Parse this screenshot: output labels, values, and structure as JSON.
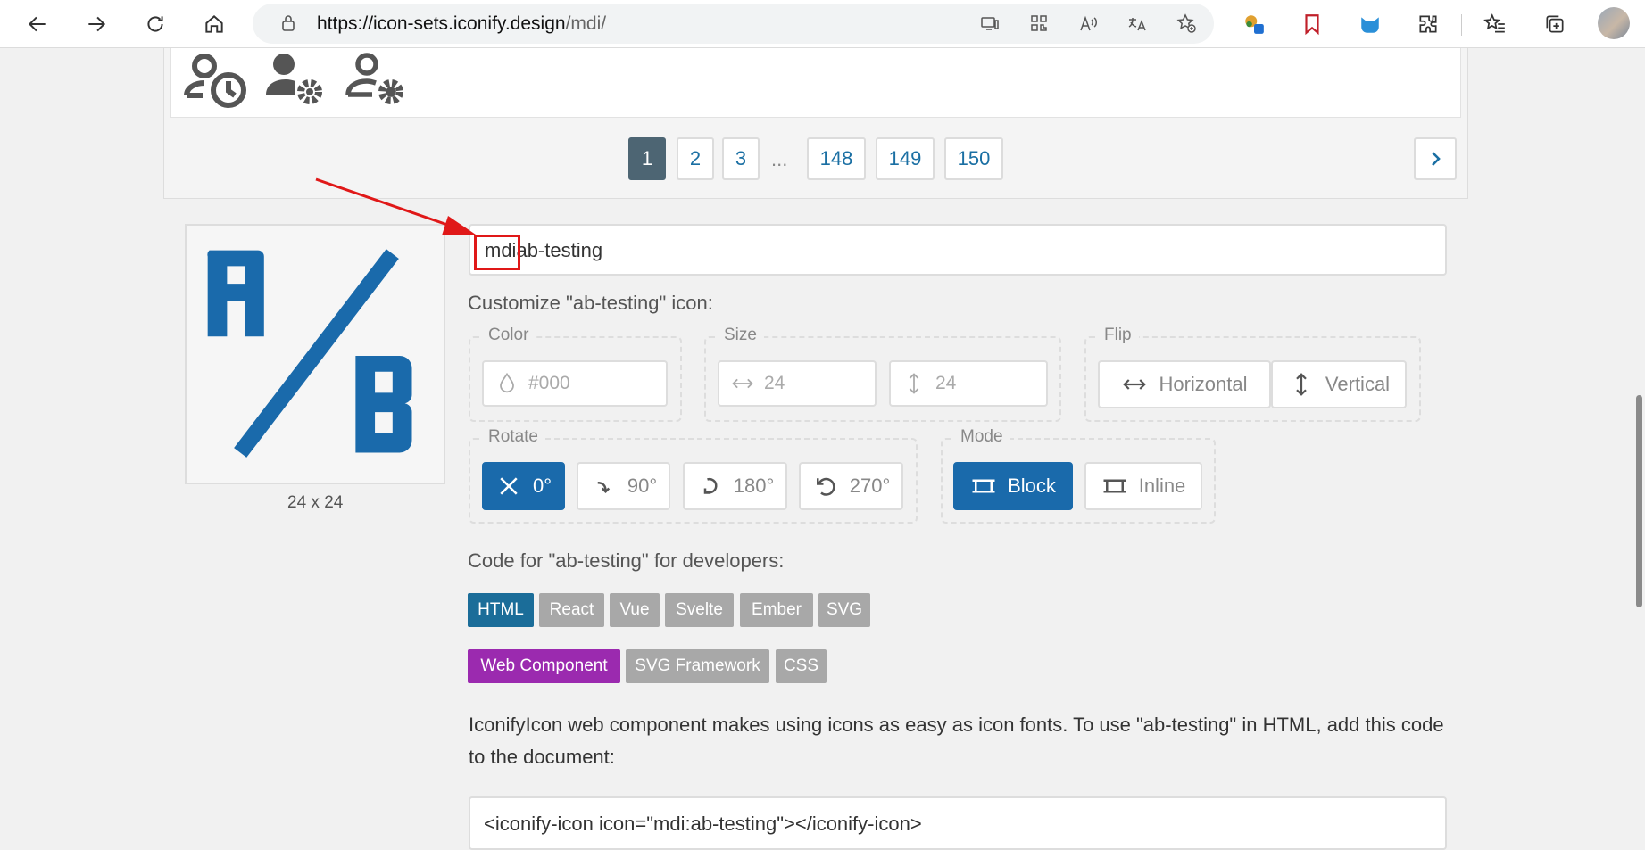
{
  "browser": {
    "url_host": "https://icon-sets.iconify.design",
    "url_path": "/mdi/",
    "colors": {
      "toolbar_bg": "#ffffff",
      "urlbar_bg": "#f1f3f4"
    }
  },
  "pagination": {
    "pages": [
      "1",
      "2",
      "3",
      "148",
      "149",
      "150"
    ],
    "ellipsis": "...",
    "active_page": "1"
  },
  "icon": {
    "name_value": "mdi:ab-testing",
    "name_prefix_shown": "mdi",
    "name_rest_shown": "ab-testing",
    "preview_size": "24 x 24",
    "color": "#1a6aab"
  },
  "customize": {
    "heading": "Customize \"ab-testing\" icon:",
    "color_legend": "Color",
    "color_placeholder": "#000",
    "size_legend": "Size",
    "width_placeholder": "24",
    "height_placeholder": "24",
    "flip_legend": "Flip",
    "flip_horizontal": "Horizontal",
    "flip_vertical": "Vertical",
    "rotate_legend": "Rotate",
    "rotate_options": [
      "0°",
      "90°",
      "180°",
      "270°"
    ],
    "mode_legend": "Mode",
    "mode_block": "Block",
    "mode_inline": "Inline"
  },
  "code": {
    "heading": "Code for \"ab-testing\" for developers:",
    "tabs_row1": [
      "HTML",
      "React",
      "Vue",
      "Svelte",
      "Ember",
      "SVG"
    ],
    "tabs_row2": [
      "Web Component",
      "SVG Framework",
      "CSS"
    ],
    "description": "IconifyIcon web component makes using icons as easy as icon fonts. To use \"ab-testing\" in HTML, add this code to the document:",
    "snippet": "<iconify-icon icon=\"mdi:ab-testing\"></iconify-icon>"
  },
  "annotation": {
    "color": "#e01818"
  }
}
